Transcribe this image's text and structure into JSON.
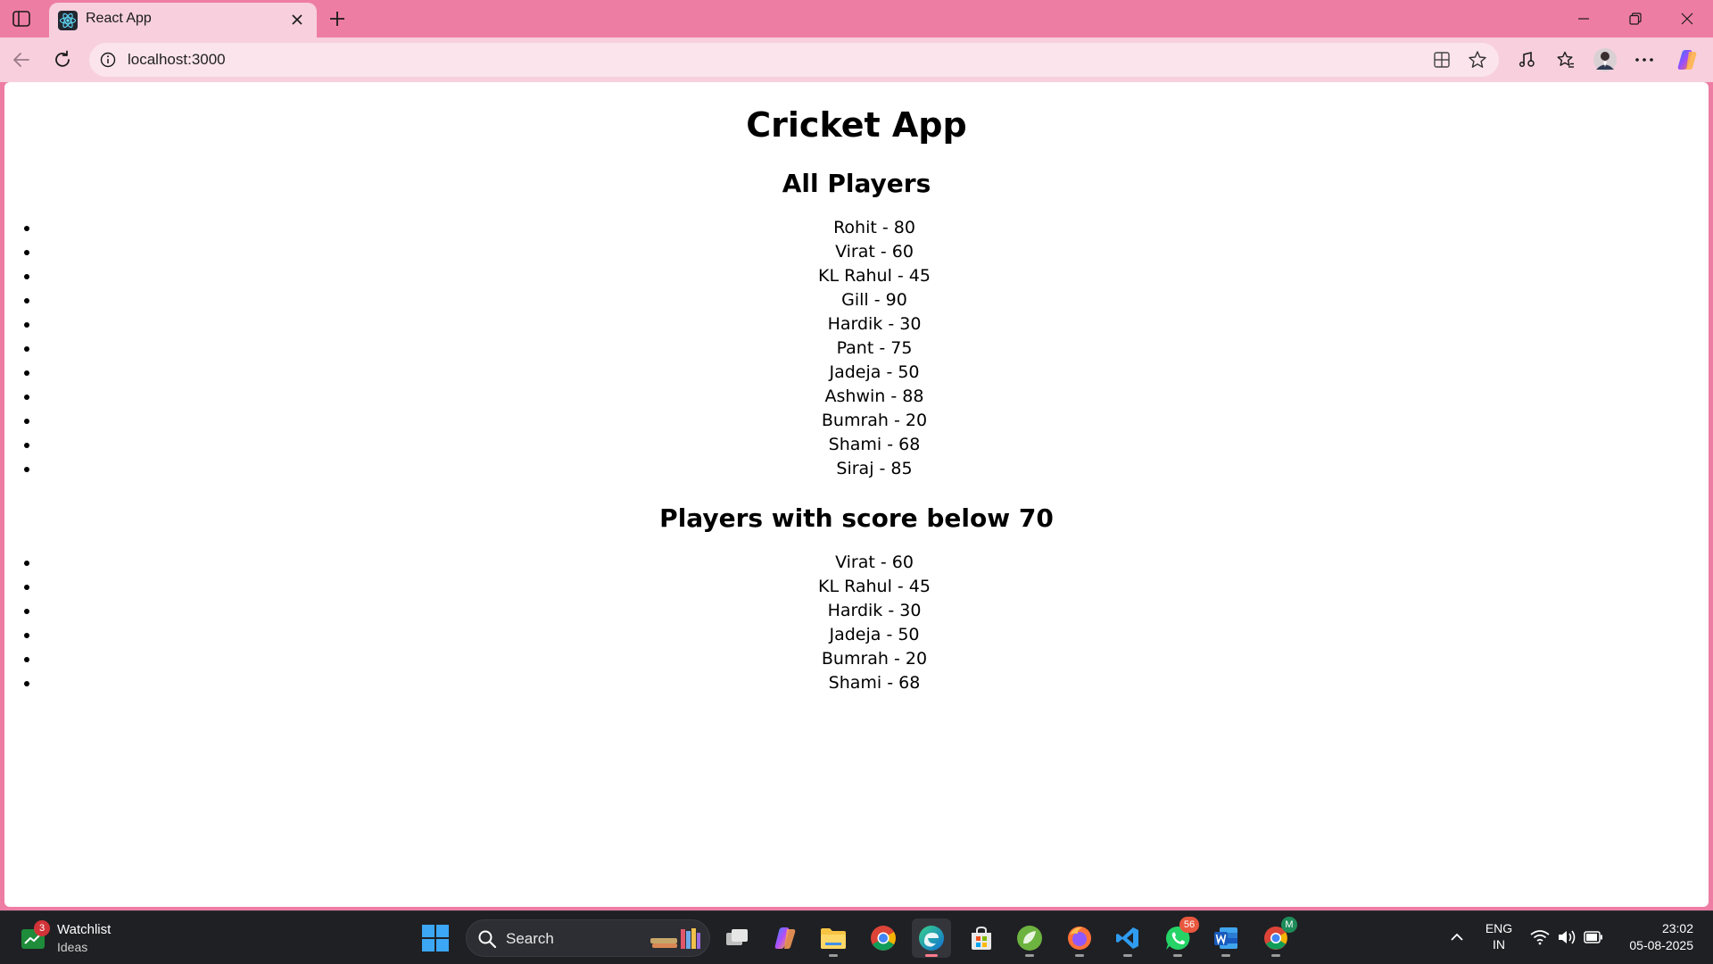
{
  "browser": {
    "tab_title": "React App",
    "url": "localhost:3000",
    "icons": {
      "tab_actions": "tab-actions-icon",
      "favicon": "react-logo-icon",
      "close_tab": "close-icon",
      "new_tab": "plus-icon",
      "back": "back-arrow-icon",
      "refresh": "refresh-icon",
      "site_info": "info-icon",
      "app_available": "app-available-icon",
      "favorite": "star-icon",
      "media": "music-icon",
      "favorites_bar": "favorites-icon",
      "profile": "profile-avatar",
      "more": "more-icon",
      "copilot": "copilot-icon"
    },
    "colors": {
      "frame": "#ee7da3",
      "toolbar": "#f7cfdd"
    }
  },
  "page": {
    "title": "Cricket App",
    "all_players_heading": "All Players",
    "all_players": [
      "Rohit - 80",
      "Virat - 60",
      "KL Rahul - 45",
      "Gill - 90",
      "Hardik - 30",
      "Pant - 75",
      "Jadeja - 50",
      "Ashwin - 88",
      "Bumrah - 20",
      "Shami - 68",
      "Siraj - 85"
    ],
    "below_70_heading": "Players with score below 70",
    "below_70_players": [
      "Virat - 60",
      "KL Rahul - 45",
      "Hardik - 30",
      "Jadeja - 50",
      "Bumrah - 20",
      "Shami - 68"
    ]
  },
  "taskbar": {
    "widget_title": "Watchlist",
    "widget_subtitle": "Ideas",
    "widget_badge": "3",
    "search_label": "Search",
    "whatsapp_badge": "56",
    "chrome_profile_badge": "M",
    "language_line1": "ENG",
    "language_line2": "IN",
    "time": "23:02",
    "date": "05-08-2025"
  }
}
